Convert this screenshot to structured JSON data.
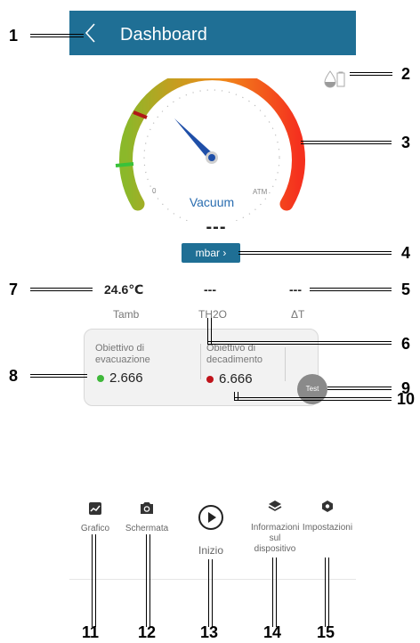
{
  "header": {
    "title": "Dashboard",
    "back_icon": "chevron-left-icon"
  },
  "gauge": {
    "scale_min_label": "0",
    "scale_max_label": "ATM",
    "mode_label": "Vacuum",
    "pressure_value": "---",
    "unit_button_label": "mbar ›",
    "colors": {
      "arc_start": "#8bb82a",
      "arc_mid": "#f08a1a",
      "arc_end": "#f5311e",
      "needle": "#1f4fa8"
    }
  },
  "status_icon": "drop-battery-icon",
  "readings": [
    {
      "value": "24.6℃",
      "label": "Tamb"
    },
    {
      "value": "---",
      "label": "TH2O"
    },
    {
      "value": "---",
      "label": "ΔT"
    }
  ],
  "targets": {
    "evacuation": {
      "label": "Obiettivo di evacuazione",
      "value": "2.666",
      "dot_color": "#3fb83a"
    },
    "decay": {
      "label": "Obiettivo di decadimento",
      "value": "6.666",
      "dot_color": "#c0141b"
    },
    "test_button_label": "Test"
  },
  "bottom_nav": {
    "chart": {
      "label": "Grafico",
      "icon": "chart-icon"
    },
    "screenshot": {
      "label": "Schermata",
      "icon": "camera-icon"
    },
    "start": {
      "label": "Inizio",
      "icon": "play-icon"
    },
    "device_info": {
      "label": "Informazioni sul dispositivo",
      "icon": "layers-icon"
    },
    "settings": {
      "label": "Impostazioni",
      "icon": "gear-hex-icon"
    }
  },
  "callouts": [
    "1",
    "2",
    "3",
    "4",
    "5",
    "6",
    "7",
    "8",
    "9",
    "10",
    "11",
    "12",
    "13",
    "14",
    "15"
  ]
}
